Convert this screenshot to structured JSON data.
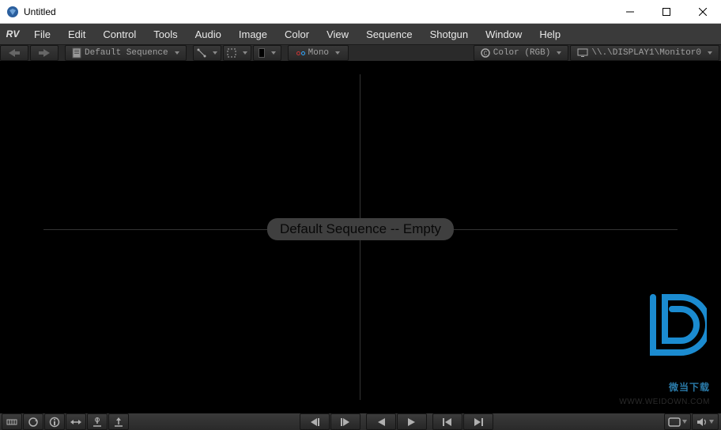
{
  "window": {
    "title": "Untitled"
  },
  "menubar": {
    "brand": "RV",
    "items": [
      "File",
      "Edit",
      "Control",
      "Tools",
      "Audio",
      "Image",
      "Color",
      "View",
      "Sequence",
      "Shotgun",
      "Window",
      "Help"
    ]
  },
  "toolbar": {
    "sequence_label": "Default Sequence",
    "stereo_label": "Mono",
    "color_label": "Color (RGB)",
    "display_label": "\\\\.\\DISPLAY1\\Monitor0"
  },
  "viewport": {
    "overlay": "Default Sequence -- Empty"
  },
  "watermark": {
    "text": "微当下载",
    "url": "WWW.WEIDOWN.COM"
  }
}
